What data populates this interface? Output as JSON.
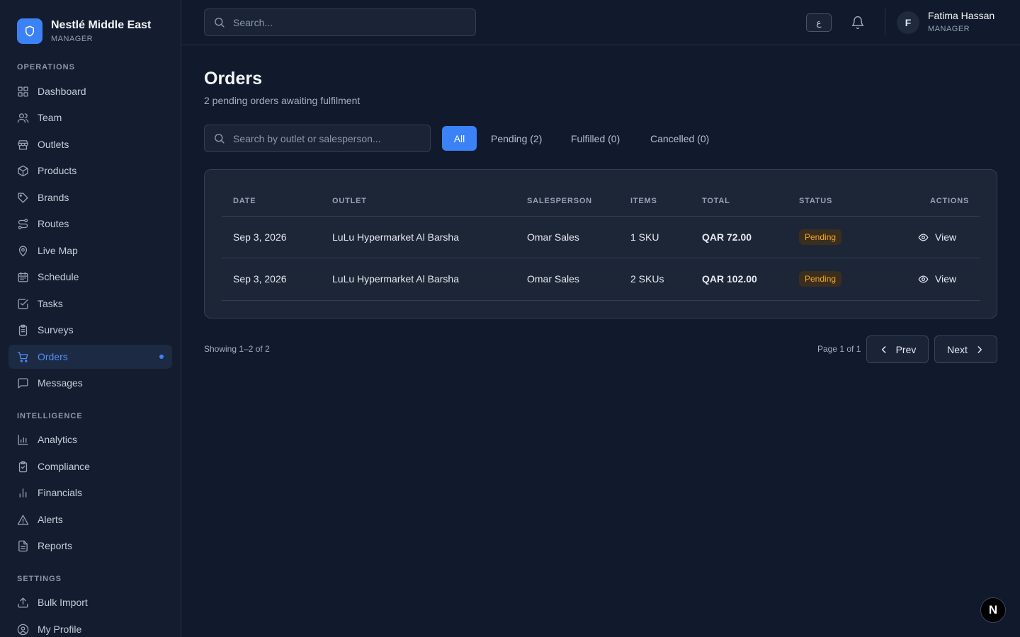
{
  "brand": {
    "name": "Nestlé Middle East",
    "role": "MANAGER"
  },
  "sidebar": {
    "sections": [
      {
        "title": "OPERATIONS"
      },
      {
        "title": "INTELLIGENCE"
      },
      {
        "title": "SETTINGS"
      }
    ],
    "items": [
      {
        "label": "Dashboard",
        "icon": "dashboard-icon"
      },
      {
        "label": "Team",
        "icon": "users-icon"
      },
      {
        "label": "Outlets",
        "icon": "store-icon"
      },
      {
        "label": "Products",
        "icon": "package-icon"
      },
      {
        "label": "Brands",
        "icon": "tag-icon"
      },
      {
        "label": "Routes",
        "icon": "route-icon"
      },
      {
        "label": "Live Map",
        "icon": "map-pin-icon"
      },
      {
        "label": "Schedule",
        "icon": "calendar-icon"
      },
      {
        "label": "Tasks",
        "icon": "checkbox-icon"
      },
      {
        "label": "Surveys",
        "icon": "clipboard-icon"
      },
      {
        "label": "Orders",
        "icon": "cart-icon",
        "active": true
      },
      {
        "label": "Messages",
        "icon": "message-icon"
      },
      {
        "label": "Analytics",
        "icon": "bar-chart-icon"
      },
      {
        "label": "Compliance",
        "icon": "clipboard-check-icon"
      },
      {
        "label": "Financials",
        "icon": "chart-bars-icon"
      },
      {
        "label": "Alerts",
        "icon": "warning-icon"
      },
      {
        "label": "Reports",
        "icon": "file-text-icon"
      },
      {
        "label": "Bulk Import",
        "icon": "upload-icon"
      },
      {
        "label": "My Profile",
        "icon": "user-circle-icon"
      }
    ]
  },
  "topbar": {
    "search_placeholder": "Search...",
    "lang_label": "ع",
    "user": {
      "initial": "F",
      "name": "Fatima Hassan",
      "role": "MANAGER"
    }
  },
  "main": {
    "title": "Orders",
    "subtitle": "2 pending orders awaiting fulfilment",
    "filter_placeholder": "Search by outlet or salesperson...",
    "tabs": [
      {
        "label": "All",
        "active": true
      },
      {
        "label": "Pending (2)"
      },
      {
        "label": "Fulfilled (0)"
      },
      {
        "label": "Cancelled (0)"
      }
    ],
    "table": {
      "headers": [
        "DATE",
        "OUTLET",
        "SALESPERSON",
        "ITEMS",
        "TOTAL",
        "STATUS",
        "ACTIONS"
      ],
      "rows": [
        {
          "date": "Sep 3, 2026",
          "outlet": "LuLu Hypermarket Al Barsha",
          "salesperson": "Omar Sales",
          "items": "1 SKU",
          "total": "QAR 72.00",
          "status": "Pending",
          "action": "View"
        },
        {
          "date": "Sep 3, 2026",
          "outlet": "LuLu Hypermarket Al Barsha",
          "salesperson": "Omar Sales",
          "items": "2 SKUs",
          "total": "QAR 102.00",
          "status": "Pending",
          "action": "View"
        }
      ]
    },
    "pagination": {
      "showing": "Showing 1–2 of 2",
      "page_info": "Page 1 of 1",
      "prev": "Prev",
      "next": "Next"
    }
  },
  "dev_badge": "N",
  "colors": {
    "accent": "#3b82f6",
    "pending": "#f5a524",
    "background": "#111a2c"
  }
}
